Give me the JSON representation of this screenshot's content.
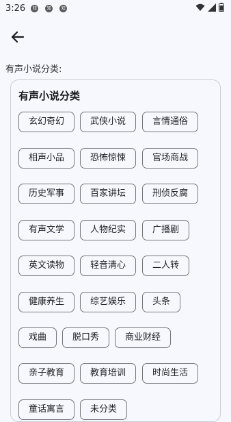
{
  "status": {
    "time": "3:26",
    "notifications": [
      "知",
      "知",
      "知"
    ]
  },
  "page": {
    "section_label": "有声小说分类:",
    "card_title": "有声小说分类"
  },
  "categories": [
    "玄幻奇幻",
    "武侠小说",
    "言情通俗",
    "相声小品",
    "恐怖惊悚",
    "官场商战",
    "历史军事",
    "百家讲坛",
    "刑侦反腐",
    "有声文学",
    "人物纪实",
    "广播剧",
    "英文读物",
    "轻音清心",
    "二人转",
    "健康养生",
    "综艺娱乐",
    "头条",
    "戏曲",
    "脱口秀",
    "商业财经",
    "亲子教育",
    "教育培训",
    "时尚生活",
    "童话寓言",
    "未分类"
  ],
  "icons": {
    "back": "arrow-left-icon",
    "wifi": "wifi-icon",
    "signal": "signal-icon",
    "battery": "battery-icon"
  }
}
